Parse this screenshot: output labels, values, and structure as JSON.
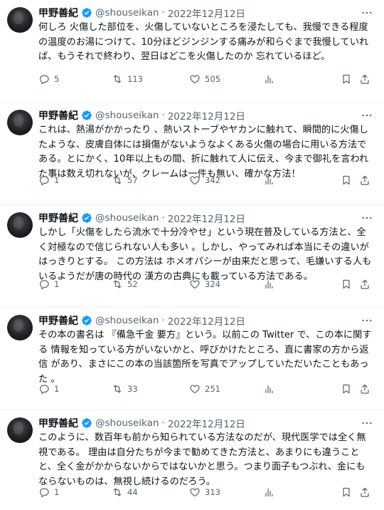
{
  "colors": {
    "text": "#0f1419",
    "secondary": "#536471",
    "verified": "#1d9bf0",
    "divider": "#eff3f4"
  },
  "icons": {
    "verified": "verified-badge-icon",
    "more": "more-icon",
    "reply": "reply-icon",
    "retweet": "retweet-icon",
    "like": "heart-icon",
    "views": "views-icon",
    "bookmark": "bookmark-icon",
    "share": "share-icon"
  },
  "tweets": [
    {
      "name": "甲野善紀",
      "handle": "@shouseikan",
      "separator": "·",
      "date": "2022年12月12日",
      "text": "何しろ 火傷した部位を、火傷していないところを浸たしても、我慢できる程度の温度のお湯につけて、10分ほどジンジンする痛みが和らぐまで我慢していれば、もうそれで終わり、翌日はどこを火傷したのか 忘れているほど。",
      "replies": "5",
      "retweets": "113",
      "likes": "505"
    },
    {
      "name": "甲野善紀",
      "handle": "@shouseikan",
      "separator": "·",
      "date": "2022年12月12日",
      "text": "これは、熱湯がかかったり 、熱いストーブやヤカンに触れて、瞬間的に火傷したような、皮膚自体には損傷がないようなよくある火傷の場合に用いる方法である。とにかく、10年以上もの間、折に触れて人に伝え、今まで御礼を言われた事は数え切れないが、クレームは一件も無い、確かな方法！",
      "replies": "1",
      "retweets": "57",
      "likes": "342"
    },
    {
      "name": "甲野善紀",
      "handle": "@shouseikan",
      "separator": "·",
      "date": "2022年12月12日",
      "text": "しかし「火傷をしたら流水で十分冷やせ」という現在普及している方法と、全く対極なので信じられない人も多い 。しかし、やってみれば本当にその違いがはっきりとする。 この方法は ホメオパシーが由来だと思って、毛嫌いする人もいるようだが唐の時代の 漢方の古典にも載っている方法である。",
      "replies": "1",
      "retweets": "52",
      "likes": "324"
    },
    {
      "name": "甲野善紀",
      "handle": "@shouseikan",
      "separator": "·",
      "date": "2022年12月12日",
      "text": "その本の書名は 『備急千金 要方』という。以前この Twitter で、この本に関する 情報を知っている方がいないかと、呼びかけたところ、直に書家の方から返信 があり、まさにこの本の当該箇所を写真でアップしていただいたこともあった 。",
      "replies": "1",
      "retweets": "33",
      "likes": "251"
    },
    {
      "name": "甲野善紀",
      "handle": "@shouseikan",
      "separator": "·",
      "date": "2022年12月12日",
      "text": "このように、数百年も前から知られている方法なのだが、現代医学では全く無視である。 理由は自分たちが今まで勧めてきた方法と、あまりにも違うことと、全く金がかからないからではないかと思う。つまり面子もつぶれ、金にもならないものは、無視し続けるのだろう。",
      "replies": "1",
      "retweets": "44",
      "likes": "313"
    }
  ]
}
